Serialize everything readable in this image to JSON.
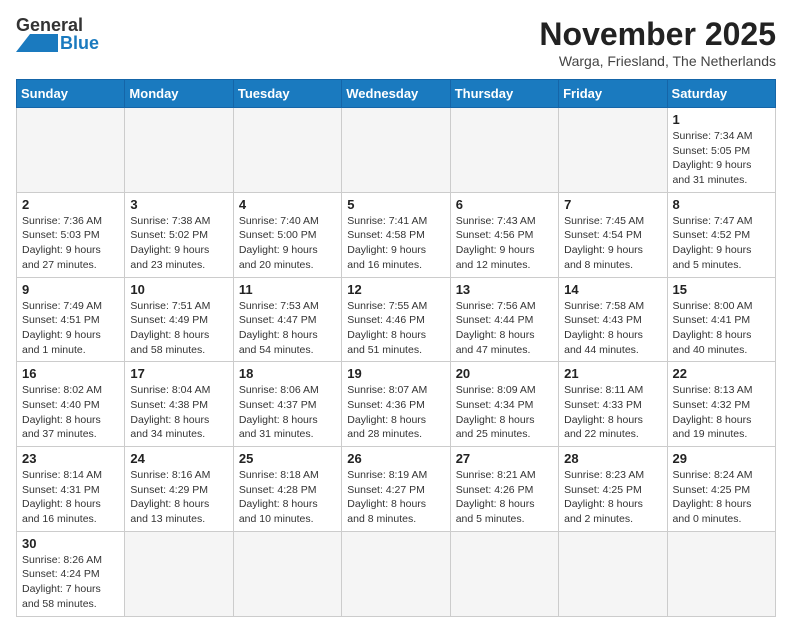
{
  "logo": {
    "text_general": "General",
    "text_blue": "Blue"
  },
  "title": "November 2025",
  "subtitle": "Warga, Friesland, The Netherlands",
  "weekdays": [
    "Sunday",
    "Monday",
    "Tuesday",
    "Wednesday",
    "Thursday",
    "Friday",
    "Saturday"
  ],
  "weeks": [
    [
      {
        "day": "",
        "info": ""
      },
      {
        "day": "",
        "info": ""
      },
      {
        "day": "",
        "info": ""
      },
      {
        "day": "",
        "info": ""
      },
      {
        "day": "",
        "info": ""
      },
      {
        "day": "",
        "info": ""
      },
      {
        "day": "1",
        "info": "Sunrise: 7:34 AM\nSunset: 5:05 PM\nDaylight: 9 hours and 31 minutes."
      }
    ],
    [
      {
        "day": "2",
        "info": "Sunrise: 7:36 AM\nSunset: 5:03 PM\nDaylight: 9 hours and 27 minutes."
      },
      {
        "day": "3",
        "info": "Sunrise: 7:38 AM\nSunset: 5:02 PM\nDaylight: 9 hours and 23 minutes."
      },
      {
        "day": "4",
        "info": "Sunrise: 7:40 AM\nSunset: 5:00 PM\nDaylight: 9 hours and 20 minutes."
      },
      {
        "day": "5",
        "info": "Sunrise: 7:41 AM\nSunset: 4:58 PM\nDaylight: 9 hours and 16 minutes."
      },
      {
        "day": "6",
        "info": "Sunrise: 7:43 AM\nSunset: 4:56 PM\nDaylight: 9 hours and 12 minutes."
      },
      {
        "day": "7",
        "info": "Sunrise: 7:45 AM\nSunset: 4:54 PM\nDaylight: 9 hours and 8 minutes."
      },
      {
        "day": "8",
        "info": "Sunrise: 7:47 AM\nSunset: 4:52 PM\nDaylight: 9 hours and 5 minutes."
      }
    ],
    [
      {
        "day": "9",
        "info": "Sunrise: 7:49 AM\nSunset: 4:51 PM\nDaylight: 9 hours and 1 minute."
      },
      {
        "day": "10",
        "info": "Sunrise: 7:51 AM\nSunset: 4:49 PM\nDaylight: 8 hours and 58 minutes."
      },
      {
        "day": "11",
        "info": "Sunrise: 7:53 AM\nSunset: 4:47 PM\nDaylight: 8 hours and 54 minutes."
      },
      {
        "day": "12",
        "info": "Sunrise: 7:55 AM\nSunset: 4:46 PM\nDaylight: 8 hours and 51 minutes."
      },
      {
        "day": "13",
        "info": "Sunrise: 7:56 AM\nSunset: 4:44 PM\nDaylight: 8 hours and 47 minutes."
      },
      {
        "day": "14",
        "info": "Sunrise: 7:58 AM\nSunset: 4:43 PM\nDaylight: 8 hours and 44 minutes."
      },
      {
        "day": "15",
        "info": "Sunrise: 8:00 AM\nSunset: 4:41 PM\nDaylight: 8 hours and 40 minutes."
      }
    ],
    [
      {
        "day": "16",
        "info": "Sunrise: 8:02 AM\nSunset: 4:40 PM\nDaylight: 8 hours and 37 minutes."
      },
      {
        "day": "17",
        "info": "Sunrise: 8:04 AM\nSunset: 4:38 PM\nDaylight: 8 hours and 34 minutes."
      },
      {
        "day": "18",
        "info": "Sunrise: 8:06 AM\nSunset: 4:37 PM\nDaylight: 8 hours and 31 minutes."
      },
      {
        "day": "19",
        "info": "Sunrise: 8:07 AM\nSunset: 4:36 PM\nDaylight: 8 hours and 28 minutes."
      },
      {
        "day": "20",
        "info": "Sunrise: 8:09 AM\nSunset: 4:34 PM\nDaylight: 8 hours and 25 minutes."
      },
      {
        "day": "21",
        "info": "Sunrise: 8:11 AM\nSunset: 4:33 PM\nDaylight: 8 hours and 22 minutes."
      },
      {
        "day": "22",
        "info": "Sunrise: 8:13 AM\nSunset: 4:32 PM\nDaylight: 8 hours and 19 minutes."
      }
    ],
    [
      {
        "day": "23",
        "info": "Sunrise: 8:14 AM\nSunset: 4:31 PM\nDaylight: 8 hours and 16 minutes."
      },
      {
        "day": "24",
        "info": "Sunrise: 8:16 AM\nSunset: 4:29 PM\nDaylight: 8 hours and 13 minutes."
      },
      {
        "day": "25",
        "info": "Sunrise: 8:18 AM\nSunset: 4:28 PM\nDaylight: 8 hours and 10 minutes."
      },
      {
        "day": "26",
        "info": "Sunrise: 8:19 AM\nSunset: 4:27 PM\nDaylight: 8 hours and 8 minutes."
      },
      {
        "day": "27",
        "info": "Sunrise: 8:21 AM\nSunset: 4:26 PM\nDaylight: 8 hours and 5 minutes."
      },
      {
        "day": "28",
        "info": "Sunrise: 8:23 AM\nSunset: 4:25 PM\nDaylight: 8 hours and 2 minutes."
      },
      {
        "day": "29",
        "info": "Sunrise: 8:24 AM\nSunset: 4:25 PM\nDaylight: 8 hours and 0 minutes."
      }
    ],
    [
      {
        "day": "30",
        "info": "Sunrise: 8:26 AM\nSunset: 4:24 PM\nDaylight: 7 hours and 58 minutes."
      },
      {
        "day": "",
        "info": ""
      },
      {
        "day": "",
        "info": ""
      },
      {
        "day": "",
        "info": ""
      },
      {
        "day": "",
        "info": ""
      },
      {
        "day": "",
        "info": ""
      },
      {
        "day": "",
        "info": ""
      }
    ]
  ]
}
